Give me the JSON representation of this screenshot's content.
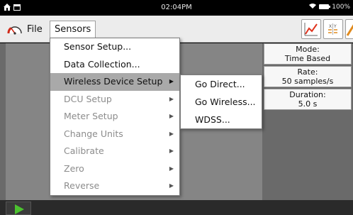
{
  "statusbar": {
    "time": "02:04PM",
    "battery": "100%"
  },
  "menubar": {
    "file_label": "File",
    "sensors_label": "Sensors"
  },
  "sensors_menu": {
    "items": [
      {
        "label": "Sensor Setup...",
        "enabled": true,
        "submenu": false
      },
      {
        "label": "Data Collection...",
        "enabled": true,
        "submenu": false
      },
      {
        "label": "Wireless Device Setup",
        "enabled": true,
        "submenu": true,
        "selected": true
      },
      {
        "label": "DCU Setup",
        "enabled": false,
        "submenu": true
      },
      {
        "label": "Meter Setup",
        "enabled": false,
        "submenu": true
      },
      {
        "label": "Change Units",
        "enabled": false,
        "submenu": true
      },
      {
        "label": "Calibrate",
        "enabled": false,
        "submenu": true
      },
      {
        "label": "Zero",
        "enabled": false,
        "submenu": true
      },
      {
        "label": "Reverse",
        "enabled": false,
        "submenu": true
      }
    ]
  },
  "wireless_submenu": {
    "items": [
      {
        "label": "Go Direct..."
      },
      {
        "label": "Go Wireless..."
      },
      {
        "label": "WDSS..."
      }
    ]
  },
  "info_panel": {
    "mode": {
      "label": "Mode:",
      "value": "Time Based"
    },
    "rate": {
      "label": "Rate:",
      "value": "50 samples/s"
    },
    "duration": {
      "label": "Duration:",
      "value": "5.0 s"
    }
  },
  "toolbar": {
    "icons": [
      "graph-view-icon",
      "table-view-icon",
      "meter-view-icon"
    ]
  },
  "colors": {
    "play": "#4cc22f",
    "menu_selected": "#a9a9a9",
    "graph_chart_icon": "#e0331d",
    "table_icon": "#e08a1d"
  }
}
